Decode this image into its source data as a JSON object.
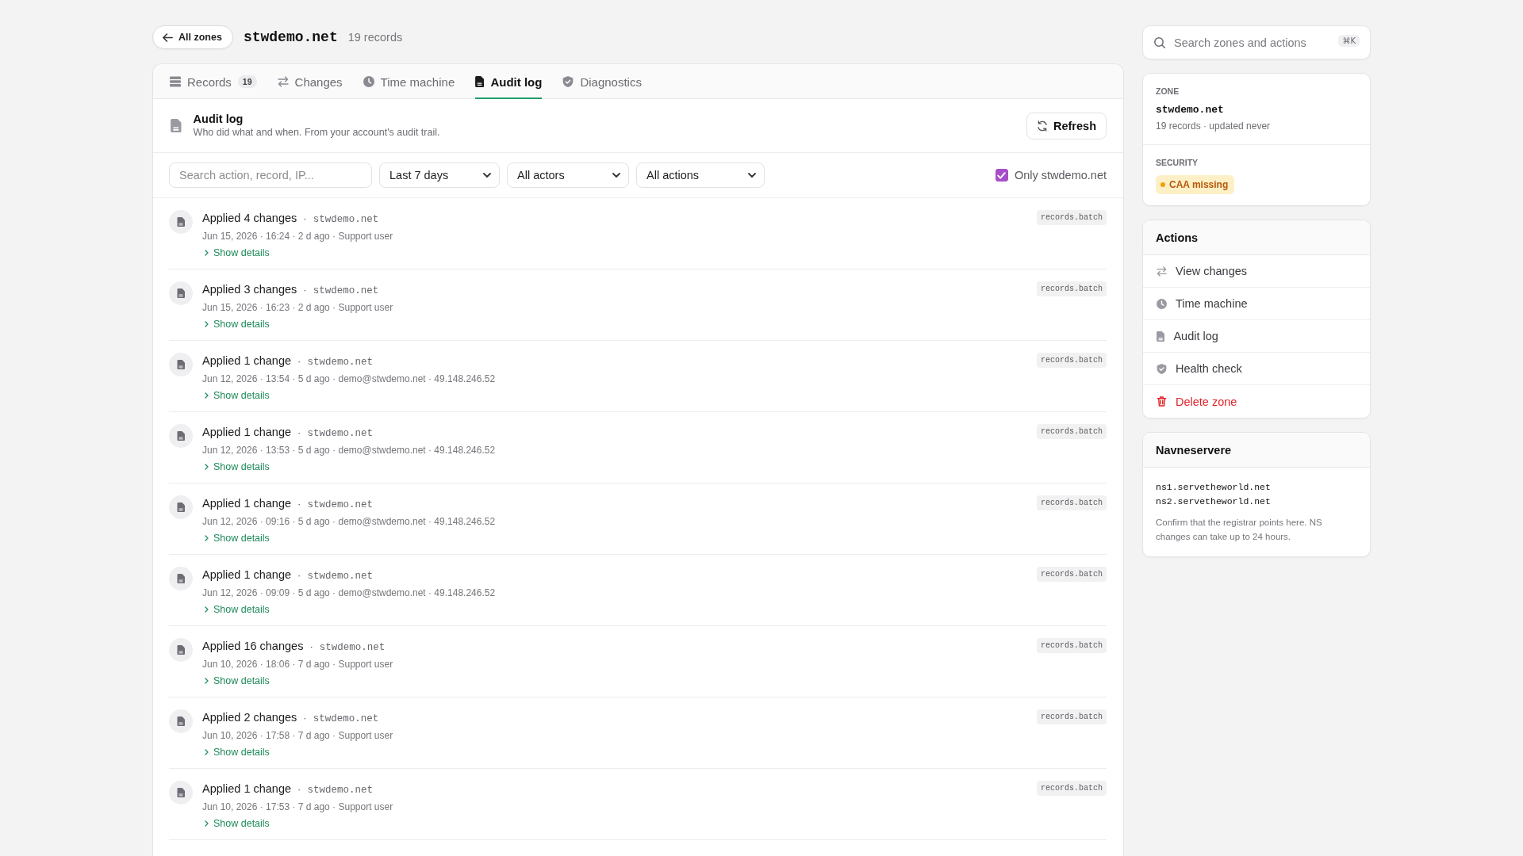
{
  "header": {
    "back_button": "All zones",
    "title": "stwdemo.net",
    "subtitle": "19 records"
  },
  "tabs": [
    {
      "label": "Records",
      "count": "19",
      "selected": false
    },
    {
      "label": "Changes",
      "selected": false
    },
    {
      "label": "Time machine",
      "selected": false
    },
    {
      "label": "Audit log",
      "selected": true
    },
    {
      "label": "Diagnostics",
      "selected": false
    }
  ],
  "section": {
    "title": "Audit log",
    "description": "Who did what and when. From your account's audit trail.",
    "refresh_button": "Refresh"
  },
  "filters": {
    "search": {
      "placeholder": "Search action, record, IP..."
    },
    "dropdowns": [
      "Last 7 days",
      "All actors",
      "All actions"
    ],
    "only_zone": {
      "label": "Only stwdemo.net",
      "checked": true
    }
  },
  "entries": [
    {
      "title": "Applied 4 changes",
      "separator": "·",
      "zone": "stwdemo.net",
      "meta": "Jun 15, 2026 · 16:24 · 2 d ago · Support user",
      "details_link": "Show details",
      "action": "records.batch"
    },
    {
      "title": "Applied 3 changes",
      "separator": "·",
      "zone": "stwdemo.net",
      "meta": "Jun 15, 2026 · 16:23 · 2 d ago · Support user",
      "details_link": "Show details",
      "action": "records.batch"
    },
    {
      "title": "Applied 1 change",
      "separator": "·",
      "zone": "stwdemo.net",
      "meta": "Jun 12, 2026 · 13:54 · 5 d ago · demo@stwdemo.net · 49.148.246.52",
      "details_link": "Show details",
      "action": "records.batch"
    },
    {
      "title": "Applied 1 change",
      "separator": "·",
      "zone": "stwdemo.net",
      "meta": "Jun 12, 2026 · 13:53 · 5 d ago · demo@stwdemo.net · 49.148.246.52",
      "details_link": "Show details",
      "action": "records.batch"
    },
    {
      "title": "Applied 1 change",
      "separator": "·",
      "zone": "stwdemo.net",
      "meta": "Jun 12, 2026 · 09:16 · 5 d ago · demo@stwdemo.net · 49.148.246.52",
      "details_link": "Show details",
      "action": "records.batch"
    },
    {
      "title": "Applied 1 change",
      "separator": "·",
      "zone": "stwdemo.net",
      "meta": "Jun 12, 2026 · 09:09 · 5 d ago · demo@stwdemo.net · 49.148.246.52",
      "details_link": "Show details",
      "action": "records.batch"
    },
    {
      "title": "Applied 16 changes",
      "separator": "·",
      "zone": "stwdemo.net",
      "meta": "Jun 10, 2026 · 18:06 · 7 d ago · Support user",
      "details_link": "Show details",
      "action": "records.batch"
    },
    {
      "title": "Applied 2 changes",
      "separator": "·",
      "zone": "stwdemo.net",
      "meta": "Jun 10, 2026 · 17:58 · 7 d ago · Support user",
      "details_link": "Show details",
      "action": "records.batch"
    },
    {
      "title": "Applied 1 change",
      "separator": "·",
      "zone": "stwdemo.net",
      "meta": "Jun 10, 2026 · 17:53 · 7 d ago · Support user",
      "details_link": "Show details",
      "action": "records.batch"
    }
  ],
  "sidebar": {
    "search": {
      "placeholder": "Search zones and actions",
      "shortcut": "⌘K"
    },
    "zone_card": {
      "label": "ZONE",
      "name": "stwdemo.net",
      "summary": "19 records · updated never",
      "security_label": "SECURITY",
      "badges": [
        {
          "text": "CAA missing",
          "color": "#f59e0b"
        }
      ]
    },
    "actions": {
      "title": "Actions",
      "items": [
        {
          "label": "View changes",
          "danger": false
        },
        {
          "label": "Time machine",
          "danger": false
        },
        {
          "label": "Audit log",
          "danger": false
        },
        {
          "label": "Health check",
          "danger": false
        },
        {
          "label": "Delete zone",
          "danger": true
        }
      ]
    },
    "nameservers": {
      "title": "Navneservere",
      "servers": [
        "ns1.servetheworld.net",
        "ns2.servetheworld.net"
      ],
      "note": "Confirm that the registrar points here. NS changes can take up to 24 hours."
    }
  }
}
